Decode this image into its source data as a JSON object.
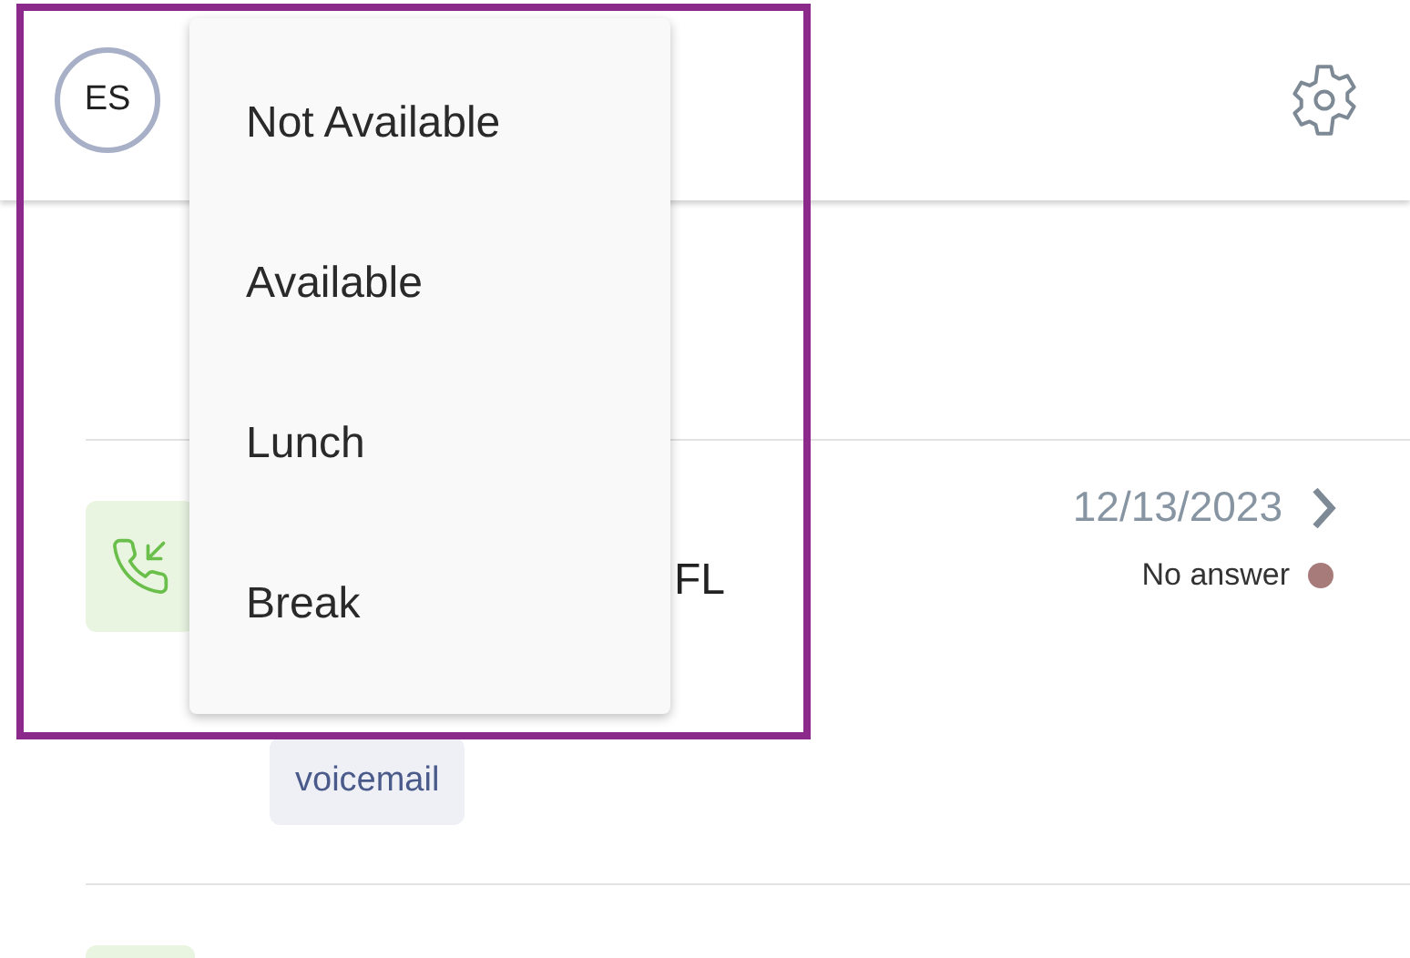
{
  "header": {
    "avatar_initials": "ES"
  },
  "status_menu": {
    "items": [
      {
        "label": "Not Available"
      },
      {
        "label": "Available"
      },
      {
        "label": "Lunch"
      },
      {
        "label": "Break"
      }
    ]
  },
  "calls": [
    {
      "kind": "incoming",
      "title": "FL",
      "date": "12/13/2023",
      "status": "No answer",
      "color": "#a67b7a",
      "tag": "voicemail"
    }
  ],
  "highlight": true
}
